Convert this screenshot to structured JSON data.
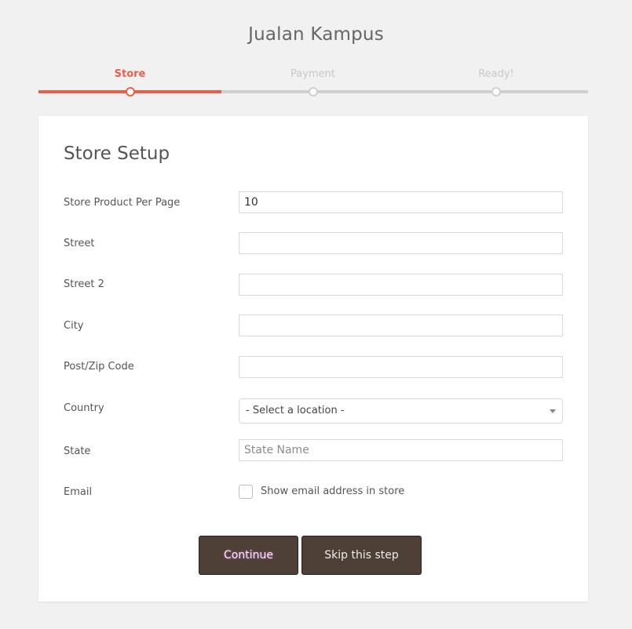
{
  "site": {
    "title": "Jualan Kampus"
  },
  "steps": [
    {
      "label": "Store",
      "active": true
    },
    {
      "label": "Payment",
      "active": false
    },
    {
      "label": "Ready!",
      "active": false
    }
  ],
  "form": {
    "heading": "Store Setup",
    "fields": {
      "per_page": {
        "label": "Store Product Per Page",
        "value": "10"
      },
      "street": {
        "label": "Street",
        "value": ""
      },
      "street2": {
        "label": "Street 2",
        "value": ""
      },
      "city": {
        "label": "City",
        "value": ""
      },
      "zip": {
        "label": "Post/Zip Code",
        "value": ""
      },
      "country": {
        "label": "Country",
        "selected": "- Select a location -"
      },
      "state": {
        "label": "State",
        "placeholder": "State Name"
      },
      "email": {
        "label": "Email",
        "checkbox_label": "Show email address in store",
        "checked": false
      }
    }
  },
  "actions": {
    "continue_label": "Continue",
    "skip_label": "Skip this step"
  },
  "colors": {
    "accent": "#e8604c",
    "button_bg": "#4f4037",
    "page_bg": "#f1f1f1"
  }
}
